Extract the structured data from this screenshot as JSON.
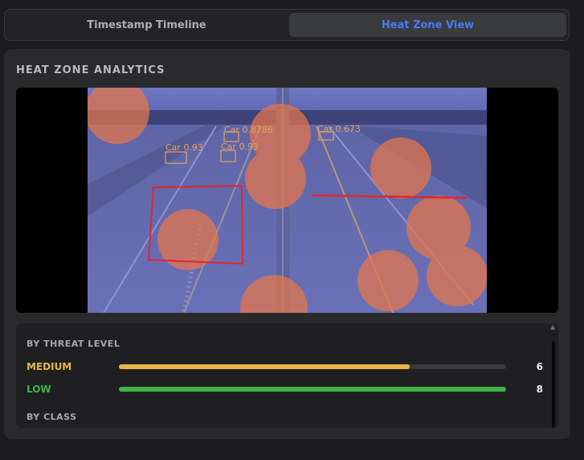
{
  "tabs": [
    {
      "label": "Timestamp Timeline",
      "active": false
    },
    {
      "label": "Heat Zone View",
      "active": true
    }
  ],
  "panel": {
    "title": "HEAT ZONE ANALYTICS"
  },
  "detections": [
    {
      "label": "Car 0.93"
    },
    {
      "label": "Car 0.93"
    },
    {
      "label": "Car 0.8786"
    },
    {
      "label": "Car 0.673"
    }
  ],
  "stats": {
    "by_threat_level_heading": "BY THREAT LEVEL",
    "levels": [
      {
        "label": "MEDIUM",
        "count": "6",
        "fraction": 0.75,
        "color": "#e8b545"
      },
      {
        "label": "LOW",
        "count": "8",
        "fraction": 1.0,
        "color": "#3fb24a"
      }
    ],
    "by_class_heading": "BY CLASS"
  },
  "colors": {
    "accent_active_tab": "#4a7cf0",
    "heat_zone": "#e8764a",
    "roi_box": "#e0262c",
    "detection_box": "#e8a05c"
  }
}
